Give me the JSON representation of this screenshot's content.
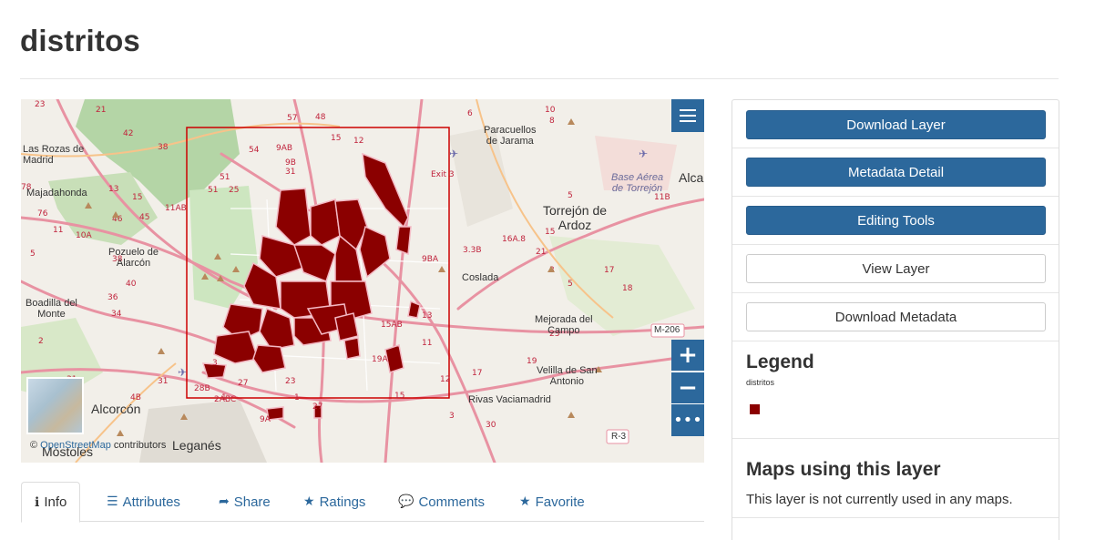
{
  "page": {
    "title": "distritos"
  },
  "map": {
    "attribution_prefix": "© ",
    "attribution_link": "OpenStreetMap",
    "attribution_suffix": " contributors",
    "zoom_in": "+",
    "zoom_out": "−",
    "more": "•••",
    "layers_icon": "menu-icon",
    "places": {
      "las_rozas": "Las Rozas de\nMadrid",
      "majadahonda": "Majadahonda",
      "pozuelo": "Pozuelo de\nAlarcón",
      "boadilla": "Boadilla del\nMonte",
      "alcorcon": "Alcorcón",
      "mostoles": "Móstoles",
      "leganes": "Leganés",
      "paracuellos": "Paracuellos\nde Jarama",
      "base_aerea": "Base Aérea\nde Torrejón",
      "alca": "Alca",
      "torrejon": "Torrejón de\nArdoz",
      "coslada": "Coslada",
      "mejorada": "Mejorada del\nCampo",
      "velilla": "Velilla de San\nAntonio",
      "rivas": "Rivas Vaciamadrid",
      "m206": "M-206",
      "r3": "R-3"
    }
  },
  "tabs": [
    {
      "label": "Info",
      "icon": "info-circle-icon"
    },
    {
      "label": "Attributes",
      "icon": "list-icon"
    },
    {
      "label": "Share",
      "icon": "share-icon"
    },
    {
      "label": "Ratings",
      "icon": "star-icon"
    },
    {
      "label": "Comments",
      "icon": "comment-icon"
    },
    {
      "label": "Favorite",
      "icon": "star-icon"
    }
  ],
  "panel": {
    "download_layer": "Download Layer",
    "metadata_detail": "Metadata Detail",
    "editing_tools": "Editing Tools",
    "view_layer": "View Layer",
    "download_metadata": "Download Metadata",
    "legend_title": "Legend",
    "legend_layer": "distritos",
    "legend_color": "#8b0000",
    "maps_title": "Maps using this layer",
    "maps_text": "This layer is not currently used in any maps."
  },
  "colors": {
    "accent": "#2c689c",
    "feature": "#8b0000",
    "bbox": "#cc0000"
  }
}
